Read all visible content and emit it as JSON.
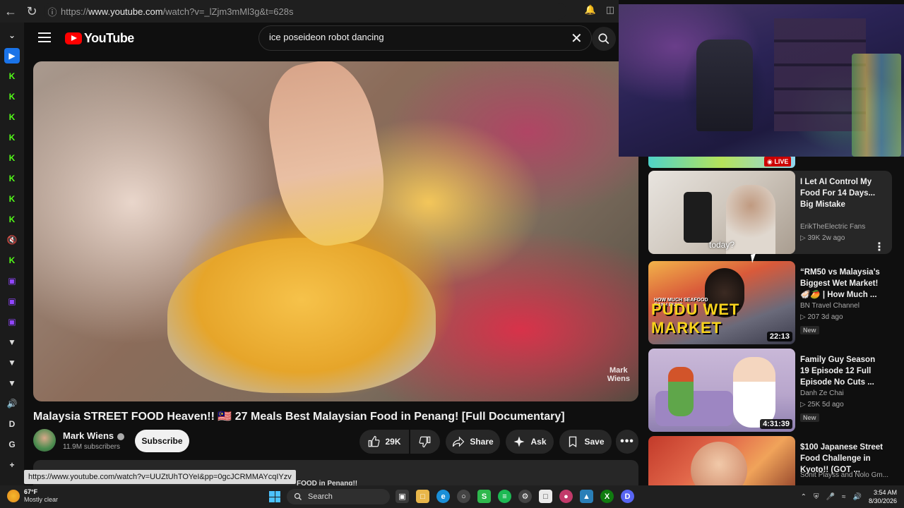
{
  "browser": {
    "url_prefix": "https://",
    "url_host": "www.youtube.com",
    "url_path": "/watch?v=_lZjm3mMl3g&t=628s"
  },
  "header": {
    "logo_text": "YouTube",
    "search_value": "ice poseideon robot dancing"
  },
  "video": {
    "title": "Malaysia STREET FOOD Heaven!! 🇲🇾 27 Meals Best Malaysian Food in Penang! [Full Documentary]",
    "watermark_line1": "Mark",
    "watermark_line2": "Wiens"
  },
  "channel": {
    "name": "Mark Wiens",
    "subscribers": "11.9M subscribers",
    "subscribe_label": "Subscribe"
  },
  "actions": {
    "like_count": "29K",
    "share_label": "Share",
    "ask_label": "Ask",
    "save_label": "Save"
  },
  "description": {
    "snippet": "FOOD in Penang!!"
  },
  "status_bar": {
    "url": "https://www.youtube.com/watch?v=UUZtUhTOYeI&pp=0gcJCRMMAYcqIYzv"
  },
  "related": {
    "live_label": "LIVE",
    "items": [
      {
        "title": "I Let AI Control My Food For 14 Days... Big Mistake",
        "channel": "ErikTheElectric Fans",
        "meta": "▷ 39K  2w ago",
        "caption": "today?",
        "duration": "",
        "badge": ""
      },
      {
        "title": "“RM50 vs Malaysia’s Biggest Wet Market! 🦪🥭 | How Much ...",
        "channel": "BN Travel Channel",
        "meta": "▷ 207  3d ago",
        "caption": "PUDU WET MARKET",
        "caption_small": "HOW MUCH SEAFOOD CAN I BUY?",
        "duration": "22:13",
        "badge": "New"
      },
      {
        "title": "Family Guy Season 19 Episode 12 Full Episode No Cuts ...",
        "channel": "Danh Ze Chai",
        "meta": "▷ 25K  5d ago",
        "duration": "4:31:39",
        "badge": "New"
      },
      {
        "title": "$100 Japanese Street Food Challenge in Kyoto!! (GOT ...",
        "channel": "Sonit Playss and Nolo Gm...",
        "meta": "",
        "duration": "",
        "badge": ""
      }
    ]
  },
  "taskbar": {
    "temperature": "67°F",
    "condition": "Mostly clear",
    "search_label": "Search",
    "time": "3:54 AM",
    "date": "8/30/2026"
  },
  "colors": {
    "yt_red": "#ff0000",
    "kick_green": "#53fc18",
    "twitch_purple": "#9146ff",
    "background": "#0f0f0f"
  }
}
